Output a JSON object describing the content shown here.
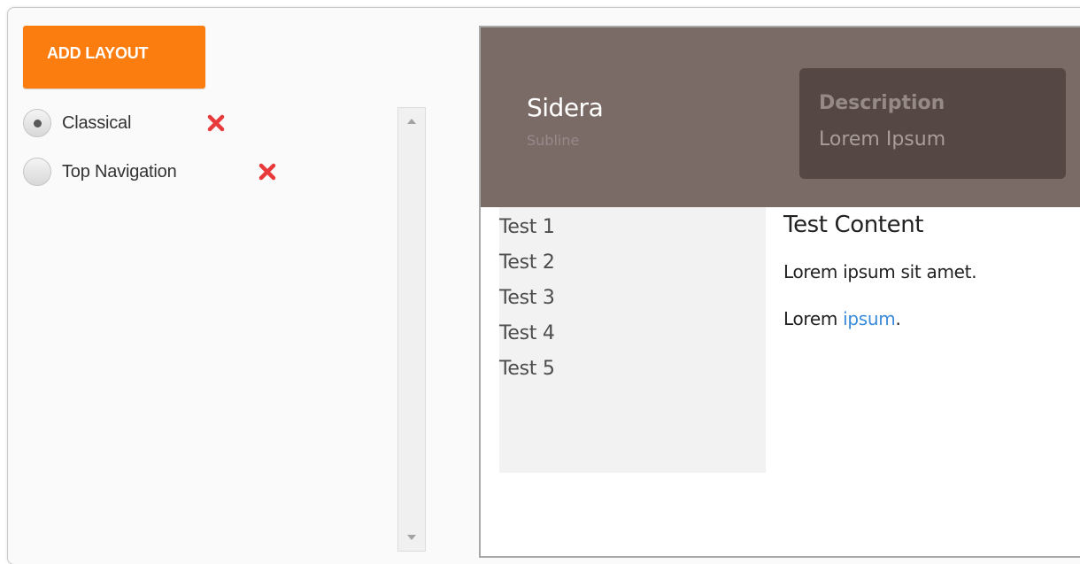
{
  "sidebar": {
    "add_button_label": "ADD LAYOUT",
    "layouts": [
      {
        "label": "Classical",
        "selected": true
      },
      {
        "label": "Top Navigation",
        "selected": false
      }
    ]
  },
  "preview": {
    "header": {
      "title": "Sidera",
      "subline": "Subline",
      "description_title": "Description",
      "description_text": "Lorem Ipsum"
    },
    "menu": [
      "Test 1",
      "Test 2",
      "Test 3",
      "Test 4",
      "Test 5"
    ],
    "content": {
      "title": "Test Content",
      "paragraph1": "Lorem ipsum sit amet.",
      "paragraph2_prefix": "Lorem ",
      "paragraph2_link": "ipsum",
      "paragraph2_suffix": "."
    }
  },
  "colors": {
    "accent": "#fb7d10",
    "header_bg": "#7b6b67",
    "description_bg": "#554743",
    "delete": "#e8393b",
    "link": "#3a8bdc"
  },
  "icons": {
    "delete": "delete-icon",
    "scroll_up": "chevron-up-icon",
    "scroll_down": "chevron-down-icon"
  }
}
